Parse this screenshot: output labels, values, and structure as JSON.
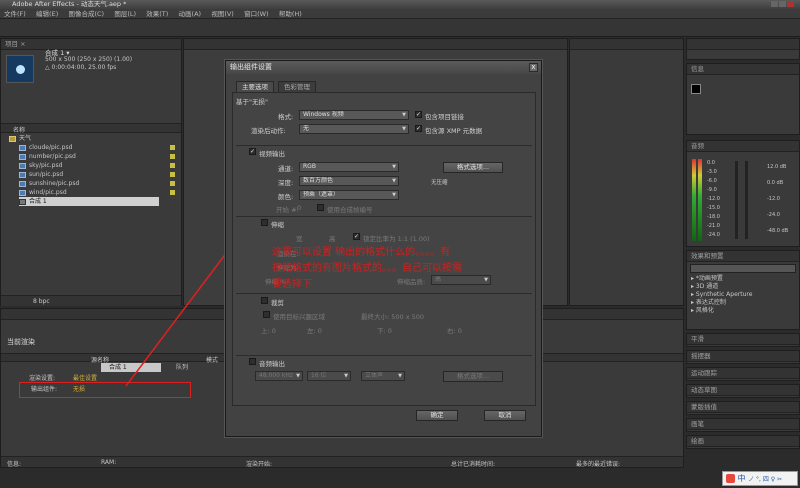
{
  "window": {
    "title": "Adobe After Effects - 动态天气.aep *"
  },
  "menu": [
    "文件(F)",
    "编辑(E)",
    "图像合成(C)",
    "图层(L)",
    "效果(T)",
    "动画(A)",
    "视图(V)",
    "窗口(W)",
    "帮助(H)"
  ],
  "project": {
    "comp_name": "合成 1 ▾",
    "comp_info1": "500 x 500 (250 x 250) (1.00)",
    "comp_info2": "△ 0:00:04:00, 25.00 fps",
    "col_name": "名称",
    "folder": "天气",
    "files": [
      "cloude/pic.psd",
      "number/pic.psd",
      "sky/pic.psd",
      "sun/pic.psd",
      "sunshine/pic.psd",
      "wind/pic.psd"
    ],
    "selected_comp": "合成 1",
    "bpc": "8 bpc"
  },
  "timeline": {
    "tab_label": "当前渲染",
    "col_source": "源名称",
    "col_mode": "模式",
    "row_item": "合成 1",
    "row_status": "队列",
    "render_settings_label": "渲染设置:",
    "render_settings_value": "最佳设置",
    "output_module_label": "输出组件:",
    "output_module_value": "无损",
    "status_bar": {
      "info": "信息:",
      "ram": "RAM:",
      "render_start": "渲染开始:",
      "elapsed": "总计已消耗时间:",
      "last_error": "最多的最近错误:"
    }
  },
  "dialog": {
    "title": "输出组件设置",
    "close": "x",
    "tabs": [
      "主要选项",
      "色彩管理"
    ],
    "based_on": "基于\"无损\"",
    "format_label": "格式:",
    "format_value": "Windows 视频",
    "include_project": "包含项目链接",
    "post_render_label": "渲染后动作:",
    "post_render_value": "无",
    "include_xmp": "包含源 XMP 元数据",
    "video_output": "视频输出",
    "channels_label": "通道:",
    "channels_value": "RGB",
    "format_options_btn": "格式选项...",
    "depth_label": "深度:",
    "depth_value": "数百万颜色",
    "codec_note": "无压缩",
    "color_label": "颜色:",
    "color_value": "预乘（遮罩）",
    "start_label": "开始 #:",
    "start_value": "0",
    "use_comp_frame": "使用合成帧编号",
    "stretch": "伸缩",
    "stretch_width": "宽",
    "stretch_height": "高",
    "lock_ratio": "锁定比率为 1:1 (1.00)",
    "render_at": "渲染在:",
    "stretch_to": "伸缩为:",
    "stretch_pct": "伸缩 %:",
    "stretch_quality": "伸缩品质:",
    "stretch_quality_value": "高",
    "crop": "裁剪",
    "use_roi": "使用目标兴趣区域",
    "final_size": "最终大小: 500 x 500",
    "crop_top": "上: 0",
    "crop_left": "左: 0",
    "crop_bottom": "下: 0",
    "crop_right": "右: 0",
    "audio_output": "音频输出",
    "audio_rate": "48.000 kHz",
    "audio_bits": "16 位",
    "audio_channel": "立体声",
    "audio_format_btn": "格式选项...",
    "ok": "确定",
    "cancel": "取消"
  },
  "annotation": {
    "line1": "这里可以设置  输出的格式什么的。。。。有",
    "line2": "视频格式的有图片格式的。。。自己可以按需",
    "line3": "要选择下",
    "color": "#d02020"
  },
  "right_panels": {
    "info_title": "信息",
    "audio_title": "音频",
    "audio_values_left": [
      "0.0",
      "-3.0",
      "-6.0",
      "-9.0",
      "-12.0",
      "-15.0",
      "-18.0",
      "-21.0",
      "-24.0"
    ],
    "audio_values_right": [
      "12.0 dB",
      "0.0 dB",
      "-12.0",
      "-24.0",
      "-48.0 dB"
    ],
    "effects_title": "效果和预置",
    "effects_items": [
      "*动画预置",
      "3D 通道",
      "Synthetic Aperture",
      "表达式控制",
      "风格化"
    ],
    "small_panels": [
      "平滑",
      "摇摆器",
      "运动跟踪",
      "动态草图",
      "蒙版插值",
      "画笔",
      "绘画"
    ]
  },
  "taskbar": {
    "ime": "中",
    "items": "ノ °, 四 ♀ ✂"
  }
}
